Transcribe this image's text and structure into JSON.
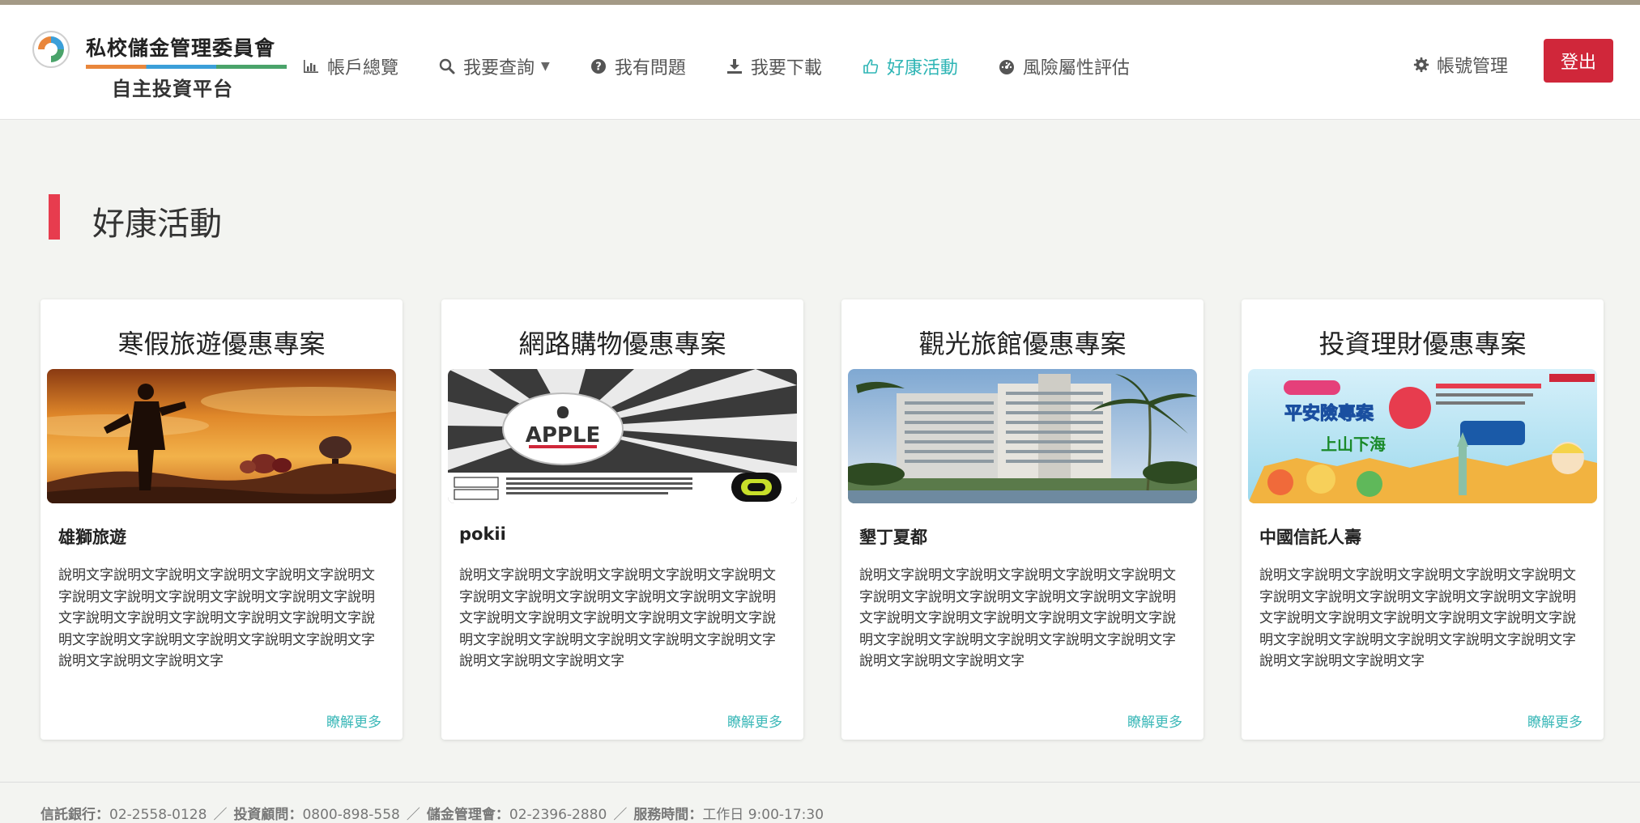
{
  "brand": {
    "name": "私校儲金管理委員會",
    "subtitle": "自主投資平台",
    "colors": {
      "orange": "#e9863b",
      "blue": "#3b9fd9",
      "green": "#4aa36a"
    }
  },
  "nav": [
    {
      "label": "帳戶總覽",
      "icon": "bar-chart-icon"
    },
    {
      "label": "我要查詢",
      "icon": "search-icon",
      "dropdown": true
    },
    {
      "label": "我有問題",
      "icon": "question-circle-icon"
    },
    {
      "label": "我要下載",
      "icon": "download-icon"
    },
    {
      "label": "好康活動",
      "icon": "thumbs-up-icon",
      "active": true
    },
    {
      "label": "風險屬性評估",
      "icon": "dashboard-icon"
    }
  ],
  "account": {
    "label": "帳號管理",
    "icon": "gear-icon"
  },
  "logout_label": "登出",
  "page_title": "好康活動",
  "cards": [
    {
      "title": "寒假旅遊優惠專案",
      "name": "雄獅旅遊",
      "description": "說明文字說明文字說明文字說明文字說明文字說明文字說明文字說明文字說明文字說明文字說明文字說明文字說明文字說明文字說明文字說明文字說明文字說明文字說明文字說明文字說明文字說明文字說明文字說明文字說明文字說明文字",
      "more": "瞭解更多"
    },
    {
      "title": "網路購物優惠專案",
      "name": "pokii",
      "description": "說明文字說明文字說明文字說明文字說明文字說明文字說明文字說明文字說明文字說明文字說明文字說明文字說明文字說明文字說明文字說明文字說明文字說明文字說明文字說明文字說明文字說明文字說明文字說明文字說明文字說明文字",
      "more": "瞭解更多",
      "image_text": "APPLE"
    },
    {
      "title": "觀光旅館優惠專案",
      "name": "墾丁夏都",
      "description": "說明文字說明文字說明文字說明文字說明文字說明文字說明文字說明文字說明文字說明文字說明文字說明文字說明文字說明文字說明文字說明文字說明文字說明文字說明文字說明文字說明文字說明文字說明文字說明文字說明文字說明文字",
      "more": "瞭解更多"
    },
    {
      "title": "投資理財優惠專案",
      "name": "中國信託人壽",
      "description": "說明文字說明文字說明文字說明文字說明文字說明文字說明文字說明文字說明文字說明文字說明文字說明文字說明文字說明文字說明文字說明文字說明文字說明文字說明文字說明文字說明文字說明文字說明文字說明文字說明文字說明文字",
      "more": "瞭解更多",
      "image_text": [
        "平安險專案",
        "上山下海"
      ]
    }
  ],
  "footer": {
    "items": [
      {
        "label": "信託銀行",
        "value": "02-2558-0128"
      },
      {
        "label": "投資顧問",
        "value": "0800-898-558"
      },
      {
        "label": "儲金管理會",
        "value": "02-2396-2880"
      },
      {
        "label": "服務時間",
        "value": "工作日 9:00-17:30"
      }
    ],
    "separator": "／",
    "colon": "："
  },
  "colors": {
    "accent": "#2fb5b5",
    "logout": "#d0273a",
    "title_bar": "#e73c4e",
    "more_link": "#3bb8b8"
  }
}
